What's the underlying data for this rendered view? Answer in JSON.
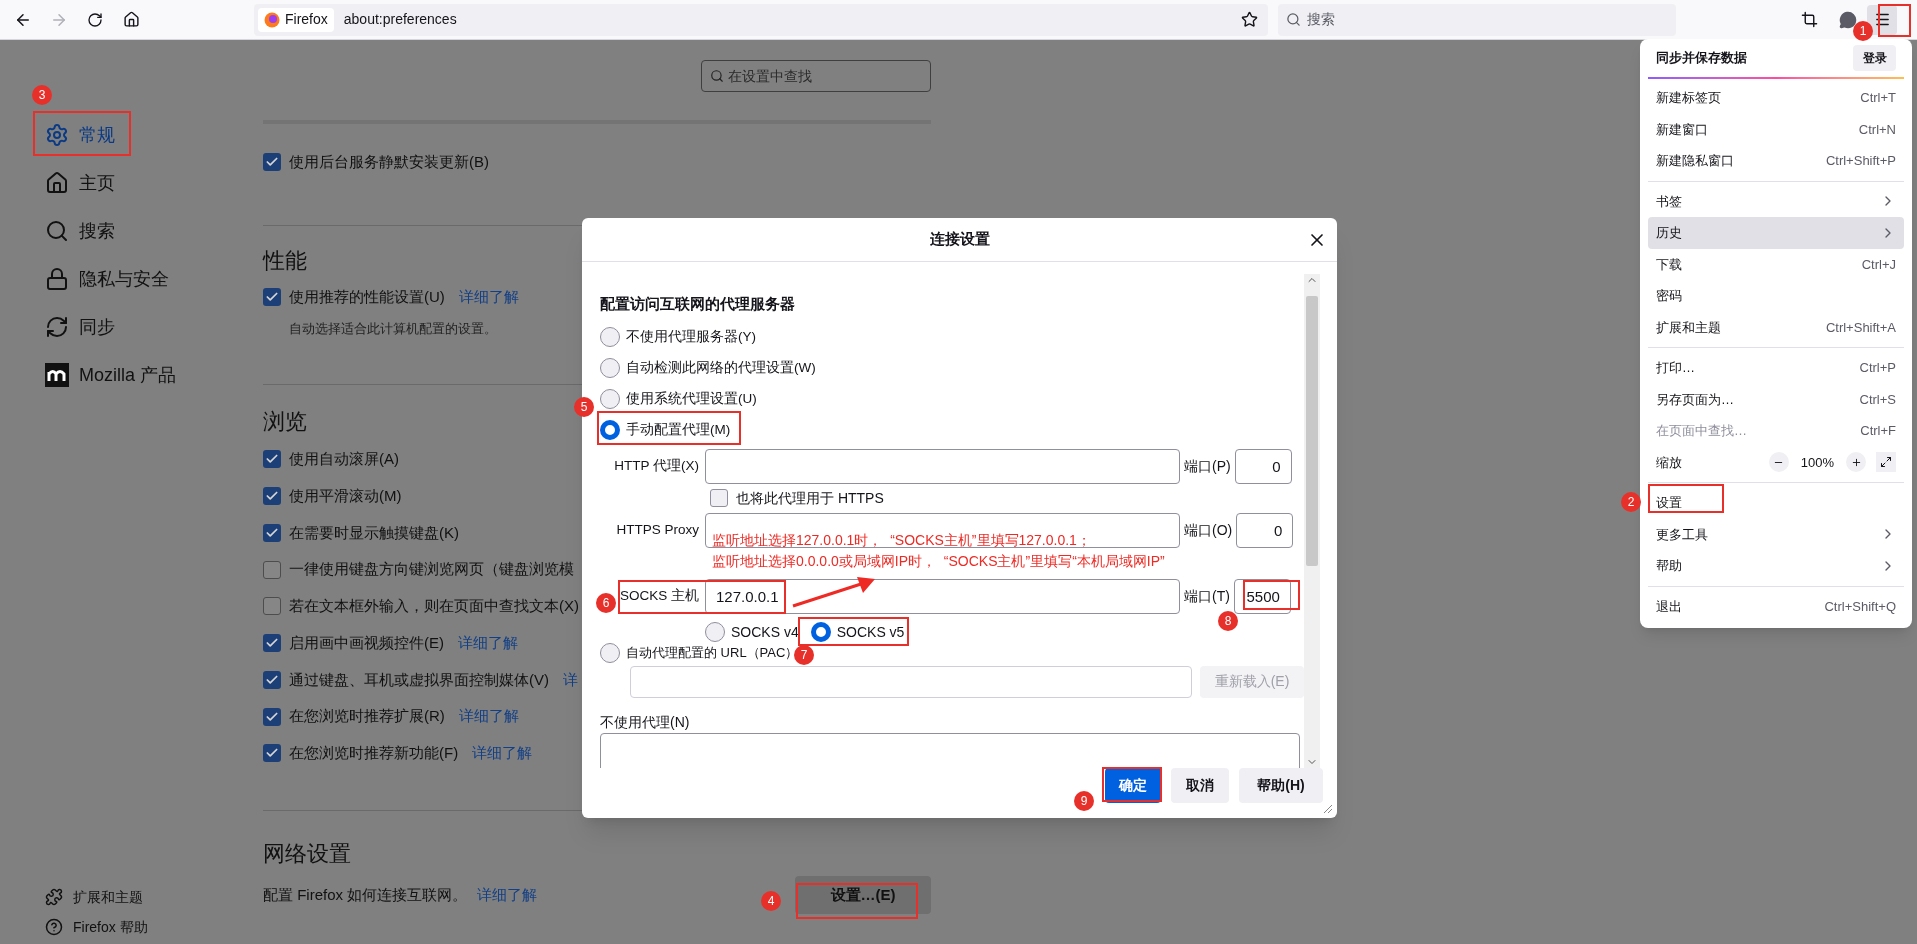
{
  "toolbar": {
    "site_label": "Firefox",
    "url": "about:preferences",
    "search_placeholder": "搜索"
  },
  "sidebar": {
    "items": [
      {
        "label": "常规",
        "selected": true
      },
      {
        "label": "主页",
        "selected": false
      },
      {
        "label": "搜索",
        "selected": false
      },
      {
        "label": "隐私与安全",
        "selected": false
      },
      {
        "label": "同步",
        "selected": false
      },
      {
        "label": "Mozilla 产品",
        "selected": false
      }
    ],
    "footer": [
      "扩展和主题",
      "Firefox 帮助"
    ]
  },
  "search": {
    "placeholder": "在设置中查找"
  },
  "updates": {
    "label": "使用后台服务静默安装更新(B)",
    "checked": true
  },
  "performance": {
    "heading": "性能",
    "items": [
      {
        "label": "使用推荐的性能设置(U)",
        "checked": true,
        "link": "详细了解"
      }
    ],
    "note": "自动选择适合此计算机配置的设置。"
  },
  "browsing": {
    "heading": "浏览",
    "items": [
      {
        "label": "使用自动滚屏(A)",
        "checked": true
      },
      {
        "label": "使用平滑滚动(M)",
        "checked": true
      },
      {
        "label": "在需要时显示触摸键盘(K)",
        "checked": true
      },
      {
        "label": "一律使用键盘方向键浏览网页（键盘浏览模",
        "checked": false
      },
      {
        "label": "若在文本框外输入，则在页面中查找文本(X)",
        "checked": false
      },
      {
        "label": "启用画中画视频控件(E)",
        "checked": true,
        "link": "详细了解"
      },
      {
        "label": "通过键盘、耳机或虚拟界面控制媒体(V)",
        "checked": true,
        "link": "详"
      },
      {
        "label": "在您浏览时推荐扩展(R)",
        "checked": true,
        "link": "详细了解"
      },
      {
        "label": "在您浏览时推荐新功能(F)",
        "checked": true,
        "link": "详细了解"
      }
    ]
  },
  "network": {
    "heading": "网络设置",
    "text": "配置 Firefox 如何连接互联网。",
    "link": "详细了解",
    "button": "设置…(E)"
  },
  "dialog": {
    "title": "连接设置",
    "heading": "配置访问互联网的代理服务器",
    "proxy_modes": [
      {
        "label": "不使用代理服务器(Y)",
        "selected": false
      },
      {
        "label": "自动检测此网络的代理设置(W)",
        "selected": false
      },
      {
        "label": "使用系统代理设置(U)",
        "selected": false
      },
      {
        "label": "手动配置代理(M)",
        "selected": true
      }
    ],
    "http": {
      "label": "HTTP 代理(X)",
      "port_label": "端口(P)",
      "port": "0"
    },
    "share_https": {
      "label": "也将此代理用于 HTTPS",
      "checked": false
    },
    "https": {
      "label": "HTTPS Proxy",
      "port_label": "端口(O)",
      "port": "0"
    },
    "socks": {
      "label": "SOCKS 主机",
      "value": "127.0.0.1",
      "port_label": "端口(T)",
      "port": "5500"
    },
    "socks_versions": [
      {
        "label": "SOCKS v4",
        "selected": false
      },
      {
        "label": "SOCKS v5",
        "selected": true
      }
    ],
    "pac": {
      "label": "自动代理配置的 URL（PAC）",
      "selected": false,
      "reload_button": "重新载入(E)"
    },
    "no_proxy_label": "不使用代理(N)",
    "buttons": [
      {
        "label": "确定",
        "kind": "primary"
      },
      {
        "label": "取消",
        "kind": "default"
      },
      {
        "label": "帮助(H)",
        "kind": "default"
      }
    ]
  },
  "app_menu": {
    "sync_title": "同步并保存数据",
    "sign_in": "登录",
    "groups": [
      [
        {
          "label": "新建标签页",
          "kind": "shortcut",
          "shortcut": "Ctrl+T",
          "selected": false,
          "disabled": false
        },
        {
          "label": "新建窗口",
          "kind": "shortcut",
          "shortcut": "Ctrl+N",
          "selected": false,
          "disabled": false
        },
        {
          "label": "新建隐私窗口",
          "kind": "shortcut",
          "shortcut": "Ctrl+Shift+P",
          "selected": false,
          "disabled": false
        }
      ],
      [
        {
          "label": "书签",
          "kind": "submenu",
          "selected": false,
          "disabled": false
        },
        {
          "label": "历史",
          "kind": "submenu",
          "selected": true,
          "disabled": false
        },
        {
          "label": "下载",
          "kind": "shortcut",
          "shortcut": "Ctrl+J",
          "selected": false,
          "disabled": false
        },
        {
          "label": "密码",
          "kind": "plain",
          "selected": false,
          "disabled": false
        },
        {
          "label": "扩展和主题",
          "kind": "shortcut",
          "shortcut": "Ctrl+Shift+A",
          "selected": false,
          "disabled": false
        }
      ],
      [
        {
          "label": "打印…",
          "kind": "shortcut",
          "shortcut": "Ctrl+P",
          "selected": false,
          "disabled": false
        },
        {
          "label": "另存页面为…",
          "kind": "shortcut",
          "shortcut": "Ctrl+S",
          "selected": false,
          "disabled": false
        },
        {
          "label": "在页面中查找…",
          "kind": "shortcut",
          "shortcut": "Ctrl+F",
          "selected": false,
          "disabled": true
        },
        {
          "label": "缩放",
          "kind": "zoom",
          "zoom_level": "100%",
          "selected": false,
          "disabled": false
        }
      ],
      [
        {
          "label": "设置",
          "kind": "plain",
          "selected": false,
          "disabled": false
        },
        {
          "label": "更多工具",
          "kind": "submenu",
          "selected": false,
          "disabled": false
        },
        {
          "label": "帮助",
          "kind": "submenu",
          "selected": false,
          "disabled": false
        }
      ],
      [
        {
          "label": "退出",
          "kind": "shortcut",
          "shortcut": "Ctrl+Shift+Q",
          "selected": false,
          "disabled": false
        }
      ]
    ]
  },
  "annotations": {
    "badges": [
      "1",
      "2",
      "3",
      "4",
      "5",
      "6",
      "7",
      "8",
      "9"
    ],
    "note_lines": [
      "监听地址选择127.0.0.1时，  “SOCKS主机”里填写127.0.0.1；",
      "监听地址选择0.0.0.0或局域网IP时，  “SOCKS主机”里填写“本机局域网IP”"
    ]
  }
}
